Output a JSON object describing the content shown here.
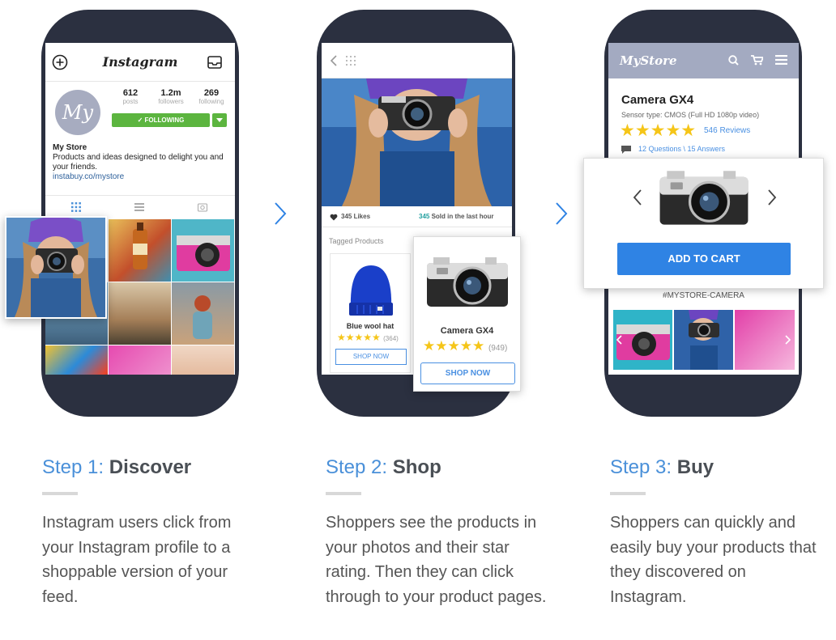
{
  "phone1": {
    "app_logo": "Instagram",
    "avatar_text": "My",
    "stats": [
      {
        "value": "612",
        "label": "posts"
      },
      {
        "value": "1.2m",
        "label": "followers"
      },
      {
        "value": "269",
        "label": "following"
      }
    ],
    "follow_label": "✓ FOLLOWING",
    "bio_name": "My Store",
    "bio_text": "Products and ideas designed to delight you and your friends.",
    "bio_link": "instabuy.co/mystore"
  },
  "phone2": {
    "likes": "345 Likes",
    "sold_count": "345",
    "sold_text": " Sold in the last hour",
    "tagged_label": "Tagged Products",
    "product1": {
      "name": "Blue wool hat",
      "stars": "★★★★★",
      "count": "(364)",
      "button": "SHOP NOW"
    },
    "product2": {
      "name": "Camera GX4",
      "stars": "★★★★★",
      "count": "(949)",
      "button": "SHOP NOW"
    }
  },
  "phone3": {
    "store_logo": "MyStore",
    "product_title": "Camera GX4",
    "sensor": "Sensor type: CMOS (Full HD 1080p video)",
    "stars": "★★★★★",
    "reviews": "546 Reviews",
    "questions": "12 Questions \\ 15 Answers",
    "add_to_cart": "ADD TO CART",
    "hashtag": "#MYSTORE-CAMERA"
  },
  "steps": [
    {
      "label": "Step 1: ",
      "name": "Discover",
      "desc": "Instagram users click from your Instagram profile to a shoppable version of your feed."
    },
    {
      "label": "Step 2: ",
      "name": "Shop",
      "desc": "Shoppers see the products in your photos and their star rating. Then they can click through to your product pages."
    },
    {
      "label": "Step 3: ",
      "name": "Buy",
      "desc": "Shoppers can quickly and easily buy your products that they discovered on Instagram."
    }
  ],
  "colors": {
    "accent_blue": "#4a90d9",
    "button_blue": "#2f83e4",
    "follow_green": "#5cb53f",
    "phone_body": "#2b3040",
    "star_yellow": "#f5c518"
  }
}
